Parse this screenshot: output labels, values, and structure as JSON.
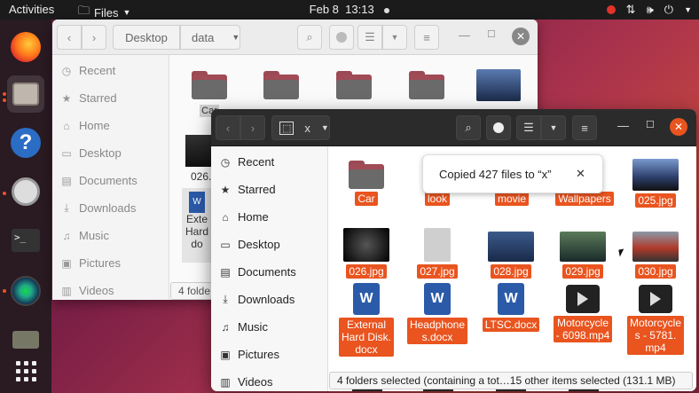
{
  "topbar": {
    "activities": "Activities",
    "app_menu": "Files",
    "date": "Feb 8",
    "time": "13:13"
  },
  "dock": {
    "items": [
      "firefox-icon",
      "files-icon",
      "help-icon",
      "disk-icon",
      "terminal-icon",
      "camera-icon",
      "trash-icon",
      "show-apps-icon"
    ]
  },
  "back_window": {
    "path": [
      "Desktop",
      "data"
    ],
    "sidebar": [
      "Recent",
      "Starred",
      "Home",
      "Desktop",
      "Documents",
      "Downloads",
      "Music",
      "Pictures",
      "Videos"
    ],
    "partial_labels": [
      "Car",
      "look",
      "movie",
      "Wallpapers",
      "026.",
      "Exte",
      "Hard",
      "do"
    ],
    "status_partial": "4 folde"
  },
  "front_window": {
    "location": "x",
    "sidebar": [
      "Recent",
      "Starred",
      "Home",
      "Desktop",
      "Documents",
      "Downloads",
      "Music",
      "Pictures",
      "Videos"
    ],
    "toast": "Copied 427 files to “x”",
    "files_row1": [
      "Car",
      "look",
      "movie",
      "Wallpapers",
      "025.jpg"
    ],
    "files_row2": [
      "026.jpg",
      "027.jpg",
      "028.jpg",
      "029.jpg",
      "030.jpg"
    ],
    "files_row3": [
      [
        "External",
        "Hard Disk.",
        "docx"
      ],
      [
        "Headphone",
        "s.docx"
      ],
      [
        "LTSC.docx"
      ],
      [
        "Motorcycle",
        "- 6098.mp4"
      ],
      [
        "Motorcycle",
        "s - 5781.",
        "mp4"
      ]
    ],
    "status": "4 folders selected (containing a tot…15 other items selected (131.1 MB)"
  },
  "colors": {
    "accent": "#e9541f",
    "topbar": "#1b1b1b",
    "dark_headerbar": "#2b2b2b"
  }
}
